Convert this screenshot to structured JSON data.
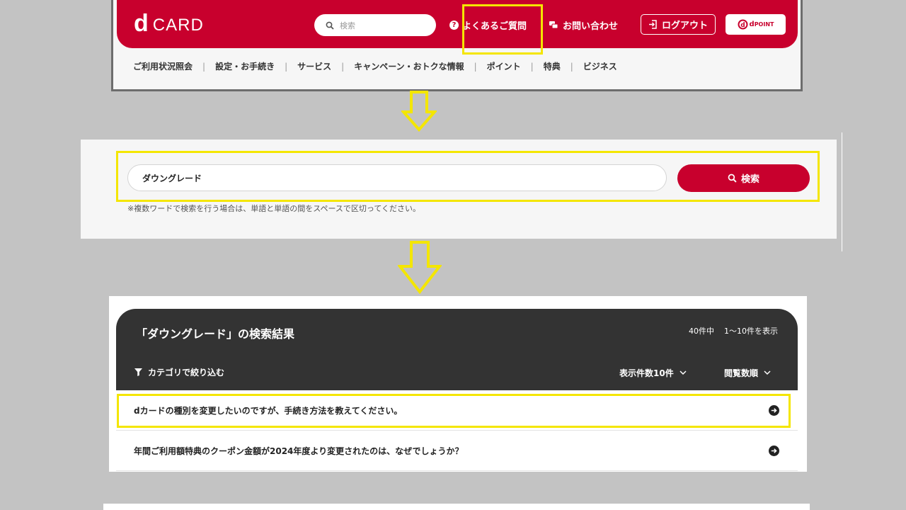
{
  "header": {
    "logo_d": "d",
    "logo_word": "CARD",
    "search_placeholder": "検索",
    "faq": "よくあるご質問",
    "contact": "お問い合わせ",
    "logout": "ログアウト",
    "dpoint_label": "POINT",
    "dpoint_mark": "d",
    "brand_color": "#c8002d",
    "menu": [
      "ご利用状況照会",
      "設定・お手続き",
      "サービス",
      "キャンペーン・おトクな情報",
      "ポイント",
      "特典",
      "ビジネス"
    ]
  },
  "search_panel": {
    "query": "ダウングレード",
    "button": "検索",
    "note": "※複数ワードで検索を行う場合は、単語と単語の間をスペースで区切ってください。"
  },
  "results": {
    "heading": "「ダウングレード」の検索結果",
    "total": "40件中",
    "range": "1～10件を表示",
    "filter": "カテゴリで絞り込む",
    "per_page": "表示件数10件",
    "sort": "閲覧数順",
    "items": [
      "dカードの種別を変更したいのですが、手続き方法を教えてください。",
      "年間ご利用額特典のクーポン金額が2024年度より変更されたのは、なぜでしょうか？"
    ]
  },
  "highlight_color": "#f4e600"
}
